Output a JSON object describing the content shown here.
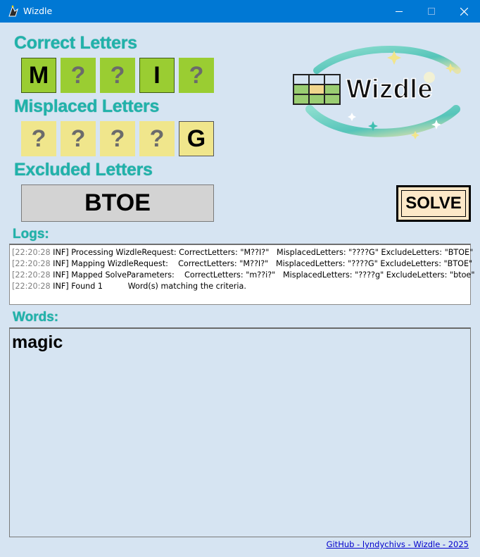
{
  "window": {
    "title": "Wizdle",
    "controls": [
      "minimize",
      "maximize",
      "close"
    ]
  },
  "correct": {
    "heading": "Correct Letters",
    "tiles": [
      "M",
      "?",
      "?",
      "I",
      "?"
    ]
  },
  "misplaced": {
    "heading": "Misplaced Letters",
    "tiles": [
      "?",
      "?",
      "?",
      "?",
      "G"
    ]
  },
  "excluded": {
    "heading": "Excluded Letters",
    "value": "BTOE"
  },
  "solve": {
    "label": "SOLVE"
  },
  "logo": {
    "text": "Wizdle"
  },
  "logs": {
    "heading": "Logs:",
    "lines": [
      {
        "time": "[22:20:28",
        "text": " INF] Processing WizdleRequest: CorrectLetters: \"M??I?\"   MisplacedLetters: \"????G\" ExcludeLetters: \"BTOE\""
      },
      {
        "time": "[22:20:28",
        "text": " INF] Mapping WizdleRequest:    CorrectLetters: \"M??I?\"   MisplacedLetters: \"????G\" ExcludeLetters: \"BTOE\""
      },
      {
        "time": "[22:20:28",
        "text": " INF] Mapped SolveParameters:    CorrectLetters: \"m??i?\"   MisplacedLetters: \"????g\" ExcludeLetters: \"btoe\""
      },
      {
        "time": "[22:20:28",
        "text": " INF] Found 1          Word(s) matching the criteria."
      }
    ]
  },
  "words": {
    "heading": "Words:",
    "items": [
      "magic"
    ]
  },
  "footer": {
    "link": "GitHub - lyndychivs - Wizdle - 2025"
  },
  "colors": {
    "titlebar": "#0078d4",
    "background": "#d6e4f2",
    "heading": "#20b2aa",
    "correct_tile": "#9acd32",
    "misplaced_tile": "#f0e68c",
    "excluded_box": "#d3d3d3",
    "solve_button": "#fde8c8"
  }
}
